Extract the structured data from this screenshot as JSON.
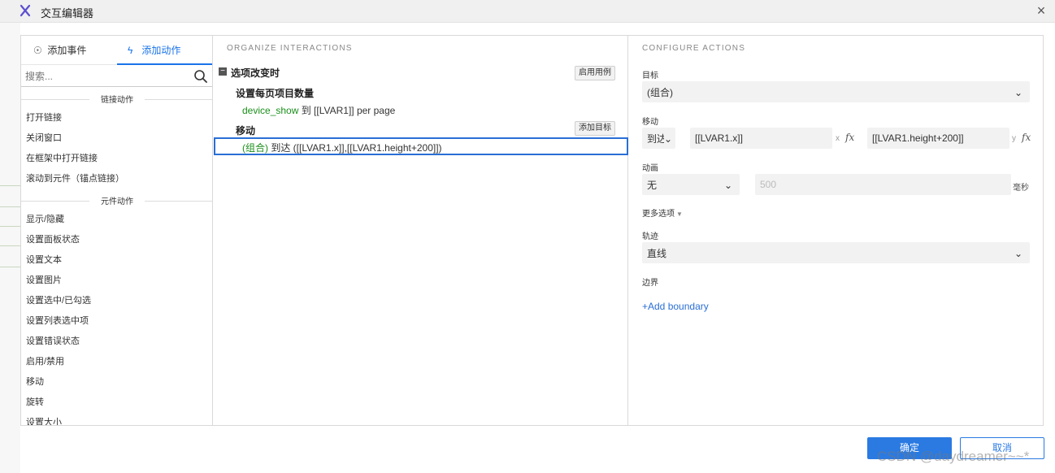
{
  "window": {
    "title": "交互编辑器",
    "close_icon": "×"
  },
  "left_panel": {
    "tabs": [
      {
        "label": "添加事件",
        "icon": "event-icon"
      },
      {
        "label": "添加动作",
        "icon": "lightning-icon",
        "active": true
      }
    ],
    "search_placeholder": "搜索...",
    "sections": [
      {
        "title": "链接动作",
        "items": [
          "打开链接",
          "关闭窗口",
          "在框架中打开链接",
          "滚动到元件（锚点链接）"
        ]
      },
      {
        "title": "元件动作",
        "items": [
          "显示/隐藏",
          "设置面板状态",
          "设置文本",
          "设置图片",
          "设置选中/已勾选",
          "设置列表选中项",
          "设置错误状态",
          "启用/禁用",
          "移动",
          "旋转",
          "设置大小"
        ]
      }
    ]
  },
  "middle_panel": {
    "heading": "ORGANIZE INTERACTIONS",
    "event": {
      "title": "选项改变时",
      "collapse": "−",
      "enable_case_button": "启用用例"
    },
    "cases": [
      {
        "title": "设置每页项目数量",
        "action": {
          "target": "device_show",
          "text": " 到 [[LVAR1]] per page"
        }
      },
      {
        "title": "移动",
        "add_target_button": "添加目标",
        "action": {
          "target": "(组合)",
          "text": " 到达 ([[LVAR1.x]],[[LVAR1.height+200]])"
        }
      }
    ]
  },
  "right_panel": {
    "heading": "CONFIGURE ACTIONS",
    "target": {
      "label": "目标",
      "value": "(组合)"
    },
    "move": {
      "label": "移动",
      "mode": "到达",
      "x_value": "[[LVAR1.x]]",
      "x_suffix": "x",
      "y_value": "[[LVAR1.height+200]]",
      "y_suffix": "y",
      "fx": "fx"
    },
    "animation": {
      "label": "动画",
      "value": "无",
      "duration_placeholder": "500",
      "unit": "毫秒"
    },
    "more_options": "更多选项",
    "trajectory": {
      "label": "轨迹",
      "value": "直线"
    },
    "boundary": {
      "label": "边界",
      "add_link": "+Add boundary"
    }
  },
  "footer": {
    "ok": "确定",
    "cancel": "取消"
  },
  "watermark": "CSDN @daydreamer~~*",
  "colors": {
    "accent": "#2a7ae2",
    "green_target": "#1b8f1b",
    "selection_border": "#2a6fd6"
  }
}
